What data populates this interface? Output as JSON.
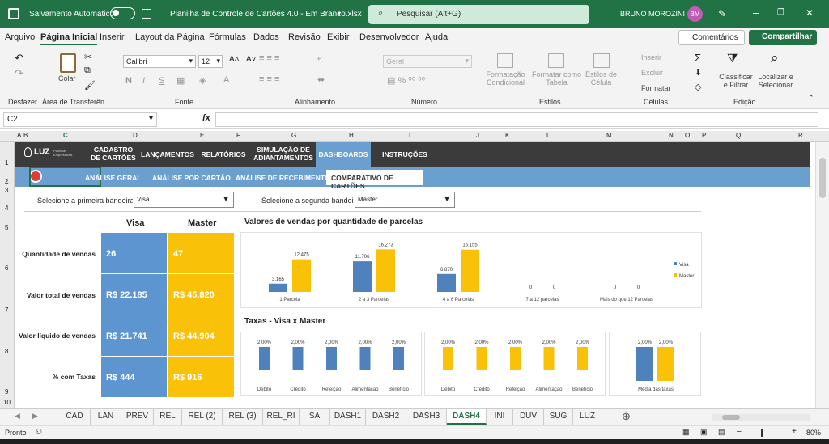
{
  "titlebar": {
    "autosave_label": "Salvamento Automático",
    "filename": "Planilha de Controle de Cartões 4.0 - Em Branco.xlsx",
    "search_placeholder": "Pesquisar (Alt+G)",
    "user": "BRUNO MOROZINI",
    "initials": "BM"
  },
  "menu": [
    "Arquivo",
    "Página Inicial",
    "Inserir",
    "Layout da Página",
    "Fórmulas",
    "Dados",
    "Revisão",
    "Exibir",
    "Desenvolvedor",
    "Ajuda"
  ],
  "menu_right": {
    "comments": "Comentários",
    "share": "Compartilhar"
  },
  "ribbon": {
    "undo_label": "Desfazer",
    "clipboard_label": "Área de Transferên...",
    "paste": "Colar",
    "font_name": "Calibri",
    "font_size": "12",
    "font_label": "Fonte",
    "bold": "N",
    "italic": "I",
    "underline": "S",
    "align_label": "Alinhamento",
    "number_format": "Geral",
    "number_label": "Número",
    "cond_fmt": "Formatação\nCondicional",
    "fmt_table": "Formatar como\nTabela",
    "cell_styles": "Estilos de\nCélula",
    "styles_label": "Estilos",
    "insert": "Inserir",
    "delete": "Excluir",
    "format": "Formatar",
    "cells_label": "Células",
    "sort": "Classificar\ne Filtrar",
    "find": "Localizar e\nSelecionar",
    "edit_label": "Edição"
  },
  "formula": {
    "cellref": "C2",
    "fx": "fx",
    "value": ""
  },
  "cols": [
    "A",
    "B",
    "C",
    "D",
    "E",
    "F",
    "G",
    "H",
    "I",
    "J",
    "K",
    "L",
    "M",
    "N",
    "O",
    "P",
    "Q",
    "R"
  ],
  "rows": [
    "1",
    "2",
    "3",
    "4",
    "5",
    "6",
    "7",
    "8",
    "9",
    "10"
  ],
  "nav": {
    "logo": "LUZ",
    "logo_sub": "Planilhas Empresariais",
    "items": [
      "CADASTRO\nDE CARTÕES",
      "LANÇAMENTOS",
      "RELATÓRIOS",
      "SIMULAÇÃO DE\nADIANTAMENTOS",
      "DASHBOARDS",
      "INSTRUÇÕES"
    ]
  },
  "subnav": [
    "ANÁLISE GERAL",
    "ANÁLISE POR CARTÃO",
    "ANÁLISE DE RECEBIMENTOS",
    "COMPARATIVO DE CARTÕES"
  ],
  "selectors": {
    "first_label": "Selecione a primeira bandeira",
    "first_value": "Visa",
    "second_label": "Selecione a segunda bandeira",
    "second_value": "Master"
  },
  "table": {
    "col1": "Visa",
    "col2": "Master",
    "rows": [
      {
        "label": "Quantidade de vendas",
        "visa": "26",
        "master": "47"
      },
      {
        "label": "Valor total de vendas",
        "visa": "R$ 22.185",
        "master": "R$ 45.820"
      },
      {
        "label": "Valor líquido de vendas",
        "visa": "R$ 21.741",
        "master": "R$ 44.904"
      },
      {
        "label": "% com Taxas",
        "visa": "R$ 444",
        "master": "R$ 916"
      }
    ]
  },
  "chart_data": [
    {
      "type": "bar",
      "title": "Valores de vendas por quantidade de parcelas",
      "categories": [
        "1 Parcela",
        "2 a 3 Parcelas",
        "4 a 6 Parcelas",
        "7 a 12 parcelas",
        "Mais do que 12 Parcelas"
      ],
      "series": [
        {
          "name": "Visa",
          "values": [
            3165,
            11706,
            6870,
            0,
            0
          ],
          "labels": [
            "3.165",
            "11.706",
            "6.870",
            "0",
            "0"
          ]
        },
        {
          "name": "Master",
          "values": [
            12475,
            16273,
            16155,
            0,
            0
          ],
          "labels": [
            "12.475",
            "16.273",
            "16.155",
            "0",
            "0"
          ]
        }
      ],
      "ylim": [
        0,
        17000
      ],
      "legend": "right"
    },
    {
      "type": "bar",
      "title": "Taxas - Visa x Master",
      "series_name": "Visa",
      "categories": [
        "Débito",
        "Crédito",
        "Refeição",
        "Alimentação",
        "Benefício"
      ],
      "values": [
        2,
        2,
        2,
        2,
        2
      ],
      "labels": [
        "2,00%",
        "2,00%",
        "2,00%",
        "2,00%",
        "2,00%"
      ]
    },
    {
      "type": "bar",
      "series_name": "Master",
      "categories": [
        "Débito",
        "Crédito",
        "Refeição",
        "Alimentação",
        "Benefício"
      ],
      "values": [
        2,
        2,
        2,
        2,
        2
      ],
      "labels": [
        "2,00%",
        "2,00%",
        "2,00%",
        "2,00%",
        "2,00%"
      ]
    },
    {
      "type": "bar",
      "categories": [
        "Média das taxas"
      ],
      "series": [
        {
          "name": "Visa",
          "values": [
            2
          ],
          "labels": [
            "2,00%"
          ]
        },
        {
          "name": "Master",
          "values": [
            2
          ],
          "labels": [
            "2,00%"
          ]
        }
      ]
    }
  ],
  "colors": {
    "visa": "#4f81bd",
    "master": "#f9c107",
    "excel_green": "#217346"
  },
  "sheets": [
    "CAD",
    "LAN",
    "PREV",
    "REL",
    "REL (2)",
    "REL (3)",
    "REL_RI",
    "SA",
    "DASH1",
    "DASH2",
    "DASH3",
    "DASH4",
    "INI",
    "DUV",
    "SUG",
    "LUZ"
  ],
  "active_sheet": "DASH4",
  "status": {
    "ready": "Pronto",
    "zoom": "80%"
  }
}
